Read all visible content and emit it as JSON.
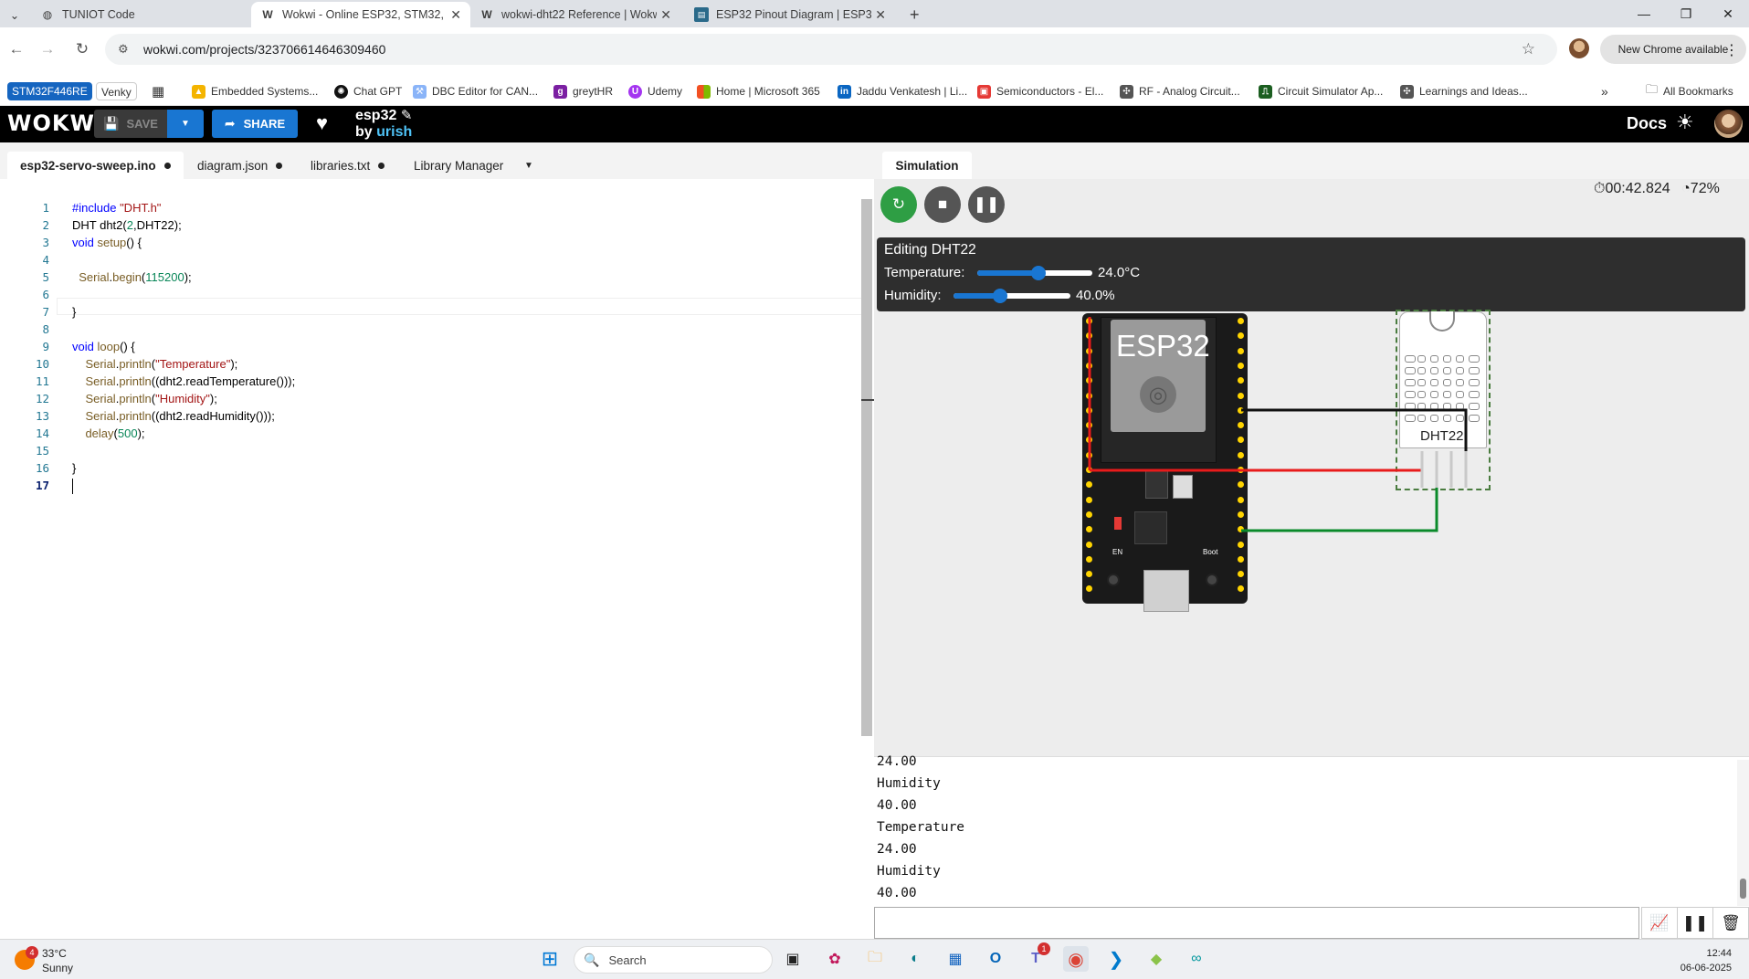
{
  "browser": {
    "tabs": [
      {
        "label": "TUNIOT Code",
        "icon": "globe-icon"
      },
      {
        "label": "Wokwi - Online ESP32, STM32,",
        "icon": "wokwi-icon",
        "active": true
      },
      {
        "label": "wokwi-dht22 Reference | Wokw",
        "icon": "wokwi-icon"
      },
      {
        "label": "ESP32 Pinout Diagram | ESP32-",
        "icon": "esp32-site-icon"
      }
    ],
    "url": "wokwi.com/projects/323706614646309460",
    "new_chrome": "New Chrome available",
    "bookmarks": [
      "STM32F446RE",
      "Venky",
      "Embedded Systems...",
      "Chat GPT",
      "DBC Editor for CAN...",
      "greytHR",
      "Udemy",
      "Home | Microsoft 365",
      "Jaddu Venkatesh | Li...",
      "Semiconductors - El...",
      "RF - Analog Circuit...",
      "Circuit Simulator Ap...",
      "Learnings and Ideas..."
    ],
    "all_bookmarks": "All Bookmarks"
  },
  "wokwi": {
    "logo": "WOKWI",
    "save": "SAVE",
    "share": "SHARE",
    "project_title": "esp32",
    "by": "by",
    "user": "urish",
    "docs": "Docs"
  },
  "editor": {
    "tabs": [
      {
        "label": "esp32-servo-sweep.ino",
        "modified": true,
        "active": true
      },
      {
        "label": "diagram.json",
        "modified": true
      },
      {
        "label": "libraries.txt",
        "modified": true
      },
      {
        "label": "Library Manager",
        "modified": false
      }
    ],
    "lines": [
      "#include \"DHT.h\"",
      "DHT dht2(2,DHT22);",
      "void setup() {",
      "",
      "  Serial.begin(115200);",
      "",
      "}",
      "",
      "void loop() {",
      "    Serial.println(\"Temperature\");",
      "    Serial.println((dht2.readTemperature()));",
      "    Serial.println(\"Humidity\");",
      "    Serial.println((dht2.readHumidity()));",
      "    delay(500);",
      "",
      "}",
      ""
    ]
  },
  "simulation": {
    "tab": "Simulation",
    "timer": "00:42.824",
    "speed": "72%",
    "popup": {
      "title": "Editing DHT22",
      "temperature_label": "Temperature:",
      "temperature_value": "24.0°C",
      "temperature_fraction": 0.53,
      "humidity_label": "Humidity:",
      "humidity_value": "40.0%",
      "humidity_fraction": 0.4
    },
    "esp32_label": "ESP32",
    "dht_label": "DHT22",
    "en_label": "EN",
    "boot_label": "Boot"
  },
  "serial": {
    "lines": [
      "24.00",
      "Humidity",
      "40.00",
      "Temperature",
      "24.00",
      "Humidity",
      "40.00"
    ]
  },
  "taskbar": {
    "weather_temp": "33°C",
    "weather_desc": "Sunny",
    "search": "Search",
    "time": "12:44",
    "date": "06-06-2025",
    "weather_badge": "4",
    "teams_badge": "1"
  }
}
